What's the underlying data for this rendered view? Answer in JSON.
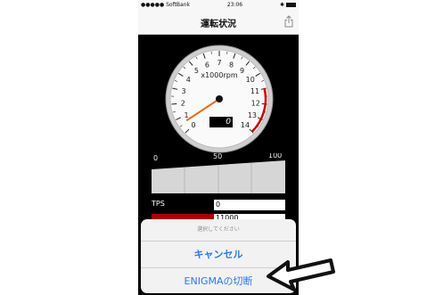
{
  "status_bar": {
    "carrier": "●●●●● SoftBank",
    "time": "23:06",
    "right": "✱"
  },
  "nav": {
    "title": "運転状況",
    "share_icon": "share-icon"
  },
  "tachometer": {
    "unit_label": "x1000rpm",
    "tick_labels": [
      "0",
      "1",
      "2",
      "3",
      "4",
      "5",
      "6",
      "7",
      "8",
      "9",
      "10",
      "11",
      "12",
      "13",
      "14"
    ],
    "needle_value": 0.6,
    "max": 14,
    "redline_from": 11,
    "readout": "0"
  },
  "throttle": {
    "tick_labels": [
      "0",
      "50",
      "100"
    ]
  },
  "tps": {
    "label": "TPS",
    "value": "0"
  },
  "rpm_row": {
    "value": "11000"
  },
  "action_sheet": {
    "title": "選択してください",
    "cancel_label": "キャンセル",
    "enigma_label": "ENIGMAの切断"
  },
  "colors": {
    "accent": "#2a7be4",
    "redline": "#cc0000"
  }
}
